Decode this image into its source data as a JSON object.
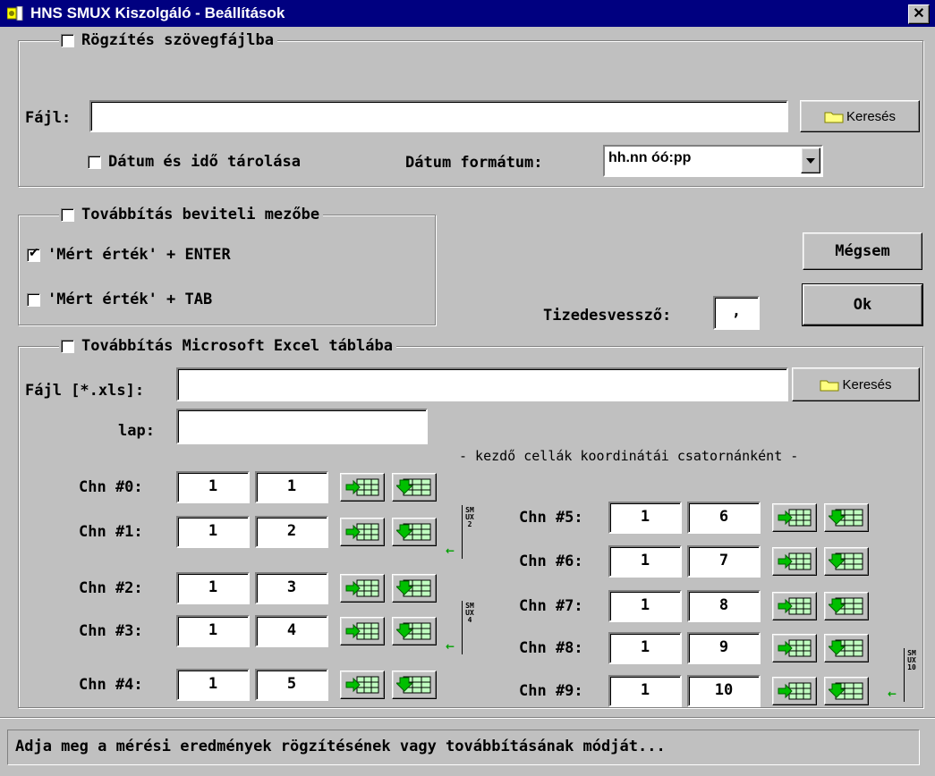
{
  "window": {
    "title": "HNS SMUX Kiszolgáló - Beállítások",
    "close_label": "✕"
  },
  "record": {
    "group_label": "Rögzítés szövegfájlba",
    "file_label": "Fájl:",
    "file_value": "",
    "browse_label": "Keresés",
    "datetime_label": "Dátum és idő tárolása",
    "format_label": "Dátum formátum:",
    "format_value": "hh.nn óó:pp"
  },
  "forward_input": {
    "group_label": "Továbbítás beviteli mezőbe",
    "enter_label": "'Mért érték' + ENTER",
    "tab_label": "'Mért érték' + TAB",
    "enter_checked": true,
    "tab_checked": false
  },
  "buttons": {
    "cancel": "Mégsem",
    "ok": "Ok"
  },
  "decimal": {
    "label": "Tizedesvessző:",
    "value": ","
  },
  "excel": {
    "group_label": "Továbbítás Microsoft Excel táblába",
    "file_label": "Fájl [*.xls]:",
    "file_value": "",
    "browse_label": "Keresés",
    "sheet_label": "lap:",
    "sheet_value": "",
    "hint": "- kezdő cellák koordinátái csatornánként -",
    "channels": [
      {
        "label": "Chn #0:",
        "row": "1",
        "col": "1"
      },
      {
        "label": "Chn #1:",
        "row": "1",
        "col": "2"
      },
      {
        "label": "Chn #2:",
        "row": "1",
        "col": "3"
      },
      {
        "label": "Chn #3:",
        "row": "1",
        "col": "4"
      },
      {
        "label": "Chn #4:",
        "row": "1",
        "col": "5"
      },
      {
        "label": "Chn #5:",
        "row": "1",
        "col": "6"
      },
      {
        "label": "Chn #6:",
        "row": "1",
        "col": "7"
      },
      {
        "label": "Chn #7:",
        "row": "1",
        "col": "8"
      },
      {
        "label": "Chn #8:",
        "row": "1",
        "col": "9"
      },
      {
        "label": "Chn #9:",
        "row": "1",
        "col": "10"
      }
    ],
    "smux_labels": [
      "SMUX2",
      "SMUX4",
      "SMUX10"
    ]
  },
  "status": {
    "text": "Adja meg a mérési eredmények rögzítésének vagy továbbításának módját..."
  },
  "colors": {
    "titlebar": "#000080",
    "face": "#c0c0c0",
    "arrow_green": "#00c000"
  }
}
